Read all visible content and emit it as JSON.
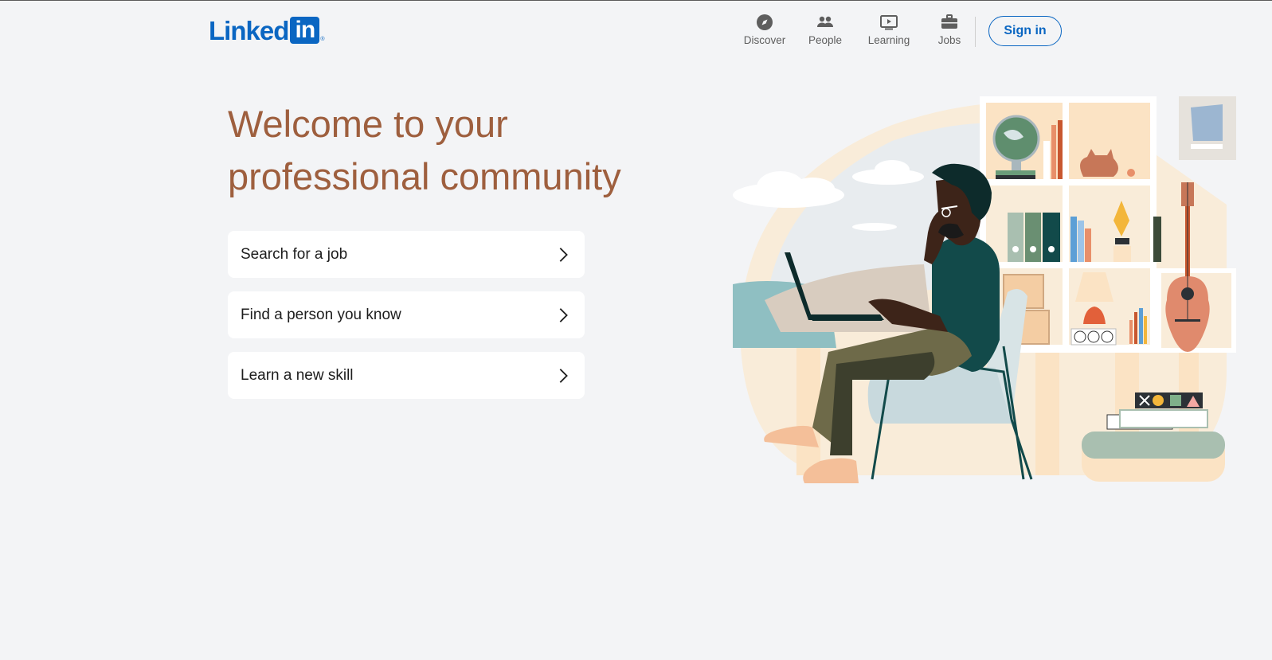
{
  "brand": {
    "logo_word": "Linked",
    "logo_box": "in",
    "logo_mark": "®"
  },
  "nav": {
    "items": [
      {
        "label": "Discover",
        "icon": "compass-icon"
      },
      {
        "label": "People",
        "icon": "people-icon"
      },
      {
        "label": "Learning",
        "icon": "play-video-icon"
      },
      {
        "label": "Jobs",
        "icon": "briefcase-icon"
      }
    ],
    "signin_label": "Sign in"
  },
  "hero": {
    "headline_line1": "Welcome to your",
    "headline_line2": "professional community"
  },
  "cards": [
    {
      "label": "Search for a job"
    },
    {
      "label": "Find a person you know"
    },
    {
      "label": "Learn a new skill"
    }
  ],
  "colors": {
    "brand_blue": "#0a66c2",
    "headline": "#9e5f3e",
    "background": "#f3f4f6"
  }
}
